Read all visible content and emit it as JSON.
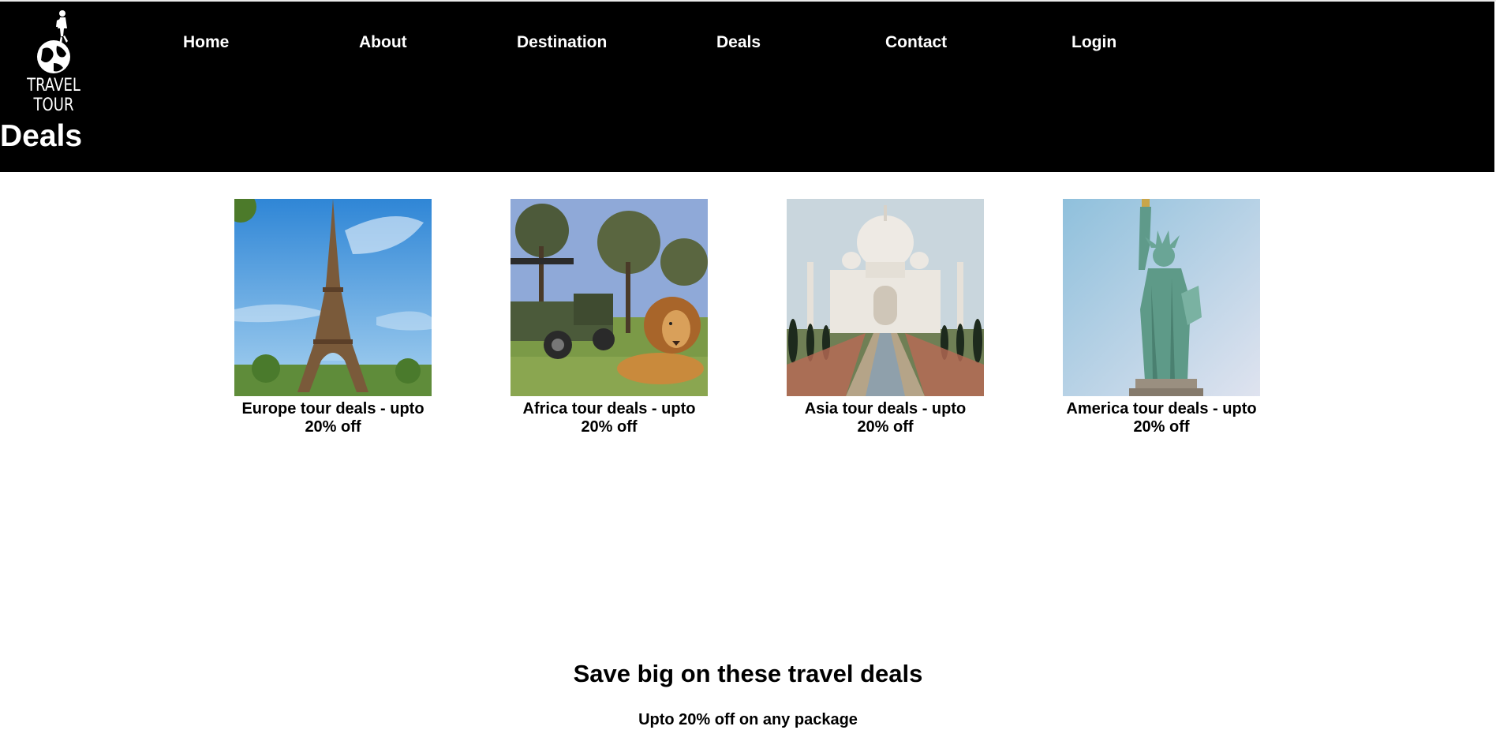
{
  "brand": {
    "name": "TRAVEL TOUR",
    "logo_icon": "traveler-on-globe-icon"
  },
  "nav": {
    "items": [
      {
        "label": "Home"
      },
      {
        "label": "About"
      },
      {
        "label": "Destination"
      },
      {
        "label": "Deals"
      },
      {
        "label": "Contact"
      },
      {
        "label": "Login"
      }
    ]
  },
  "page": {
    "title": "Deals"
  },
  "deals": [
    {
      "caption": "Europe tour deals - upto 20% off",
      "image": "eiffel-tower-photo"
    },
    {
      "caption": "Africa tour deals - upto 20% off",
      "image": "lion-safari-photo"
    },
    {
      "caption": "Asia tour deals - upto 20% off",
      "image": "taj-mahal-photo"
    },
    {
      "caption": "America tour deals - upto 20% off",
      "image": "statue-of-liberty-photo"
    }
  ],
  "promo": {
    "heading": "Save big on these travel deals",
    "subtext": "Upto 20% off on any package"
  },
  "colors": {
    "header_bg": "#000000",
    "header_text": "#ffffff",
    "body_bg": "#ffffff",
    "body_text": "#000000"
  }
}
